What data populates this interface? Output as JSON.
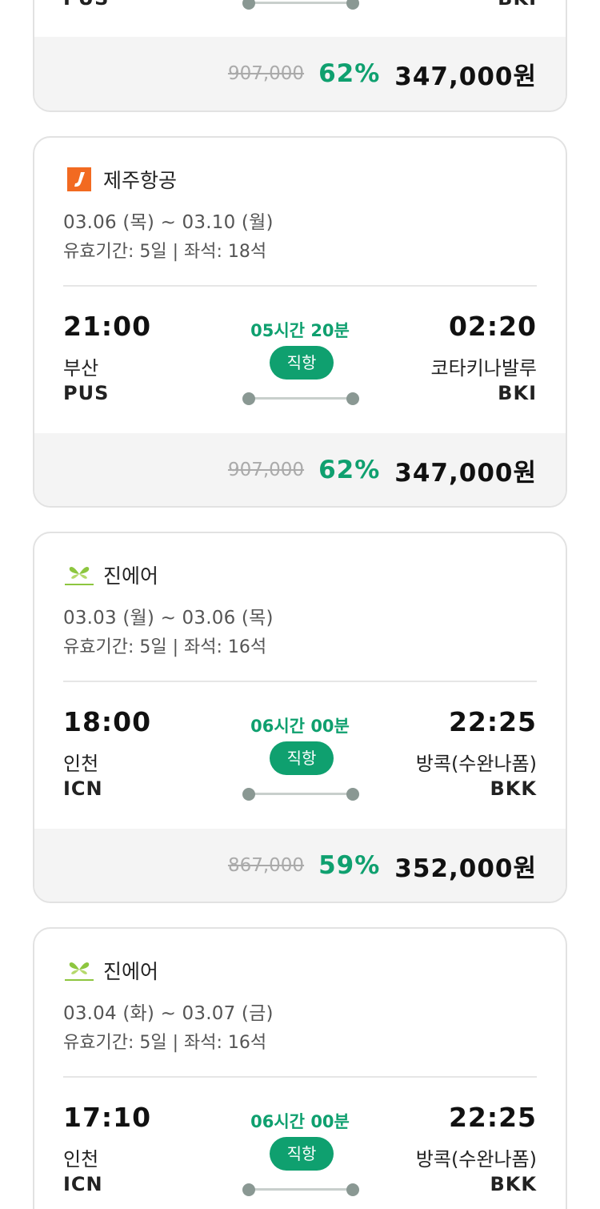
{
  "labels": {
    "direct": "직항"
  },
  "partial_top": {
    "dep_code": "PUS",
    "arr_code": "BKI",
    "original_price": "907,000",
    "discount": "62%",
    "price": "347,000원"
  },
  "flights": [
    {
      "airline": "제주항공",
      "airline_icon": "jeju-air-logo-icon",
      "dates": "03.06 (목) ~ 03.10 (월)",
      "validity": "유효기간: 5일 | 좌석: 18석",
      "dep_time": "21:00",
      "dep_city": "부산",
      "dep_code": "PUS",
      "duration": "05시간 20분",
      "arr_time": "02:20",
      "arr_city": "코타키나발루",
      "arr_code": "BKI",
      "original_price": "907,000",
      "discount": "62%",
      "price": "347,000원"
    },
    {
      "airline": "진에어",
      "airline_icon": "jinair-logo-icon",
      "dates": "03.03 (월) ~ 03.06 (목)",
      "validity": "유효기간: 5일 | 좌석: 16석",
      "dep_time": "18:00",
      "dep_city": "인천",
      "dep_code": "ICN",
      "duration": "06시간 00분",
      "arr_time": "22:25",
      "arr_city": "방콕(수완나폼)",
      "arr_code": "BKK",
      "original_price": "867,000",
      "discount": "59%",
      "price": "352,000원"
    },
    {
      "airline": "진에어",
      "airline_icon": "jinair-logo-icon",
      "dates": "03.04 (화) ~ 03.07 (금)",
      "validity": "유효기간: 5일 | 좌석: 16석",
      "dep_time": "17:10",
      "dep_city": "인천",
      "dep_code": "ICN",
      "duration": "06시간 00분",
      "arr_time": "22:25",
      "arr_city": "방콕(수완나폼)",
      "arr_code": "BKK"
    }
  ],
  "colors": {
    "accent": "#0fa06f",
    "jeju_orange": "#f26a21",
    "jinair_green": "#8dc63f"
  }
}
